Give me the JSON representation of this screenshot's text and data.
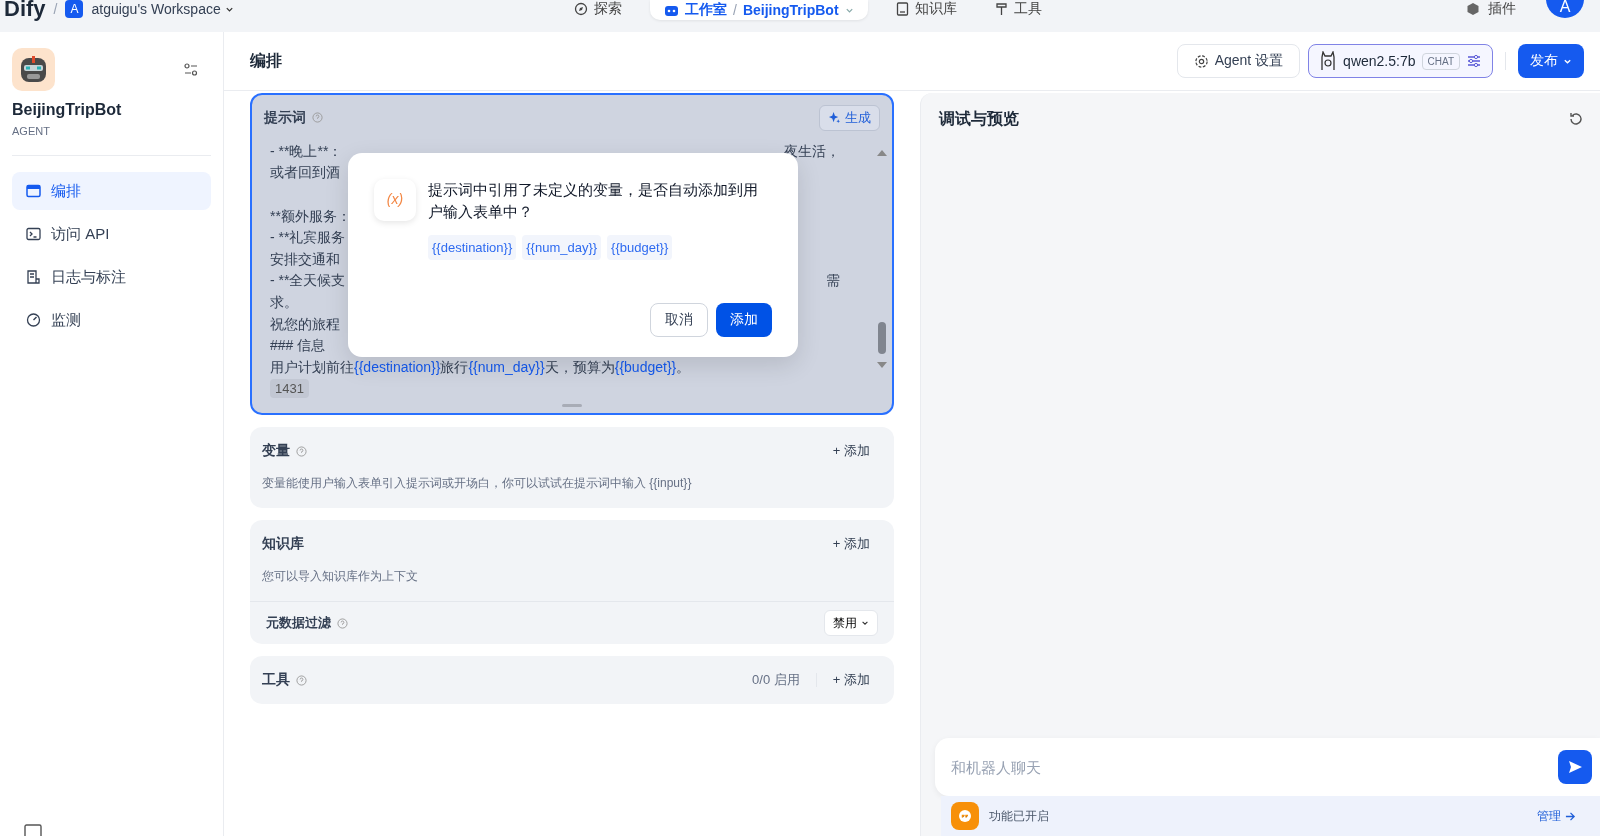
{
  "topbar": {
    "logo": "Dify",
    "separator": "/",
    "app_separator": "/",
    "workspace_initial": "A",
    "workspace": "atguigu's Workspace",
    "nav": [
      {
        "label": "探索",
        "selected": false,
        "kind": "explore"
      },
      {
        "label": "工作室",
        "selected": true,
        "kind": "studio"
      },
      {
        "label": "知识库",
        "selected": false,
        "kind": "knowledge"
      },
      {
        "label": "工具",
        "selected": false,
        "kind": "tools"
      }
    ],
    "app_name": "BeijingTripBot",
    "plugins": "插件",
    "user_initial": "A"
  },
  "sidebar": {
    "app_name": "BeijingTripBot",
    "app_type": "AGENT",
    "items": [
      {
        "label": "编排",
        "selected": true,
        "kind": "orchestrate"
      },
      {
        "label": "访问 API",
        "selected": false,
        "kind": "api"
      },
      {
        "label": "日志与标注",
        "selected": false,
        "kind": "logs"
      },
      {
        "label": "监测",
        "selected": false,
        "kind": "monitor"
      }
    ]
  },
  "page_title": "编排",
  "header_actions": {
    "agent_settings": "Agent 设置",
    "model": "qwen2.5:7b",
    "model_mode": "CHAT",
    "publish": "发布"
  },
  "prompt": {
    "title": "提示词",
    "generate": "生成",
    "lines": [
      {
        "text": "- **晚上**：",
        "tail": "夜生活，"
      },
      {
        "text": "或者回到酒"
      },
      {
        "blank": true
      },
      {
        "text": "**额外服务："
      },
      {
        "text": "- **礼宾服务"
      },
      {
        "text": "安排交通和"
      },
      {
        "text": "- **全天候支",
        "tail": "需"
      },
      {
        "text": "求。"
      },
      {
        "text": "祝您的旅程"
      },
      {
        "text": "### 信息"
      },
      {
        "segments": [
          {
            "text": "用户计划前往",
            "kind": "plain"
          },
          {
            "text": "{{destination}}",
            "kind": "var"
          },
          {
            "text": "旅行",
            "kind": "plain"
          },
          {
            "text": "{{num_day}}",
            "kind": "var"
          },
          {
            "text": "天，预算为",
            "kind": "plain"
          },
          {
            "text": "{{budget}}",
            "kind": "var"
          },
          {
            "text": "。",
            "kind": "plain"
          }
        ]
      }
    ],
    "char_count": "1431"
  },
  "modal": {
    "icon_text": "(x)",
    "message": "提示词中引用了未定义的变量，是否自动添加到用户输入表单中？",
    "variables": [
      "{{destination}}",
      "{{num_day}}",
      "{{budget}}"
    ],
    "cancel": "取消",
    "confirm": "添加"
  },
  "variables_section": {
    "title": "变量",
    "add": "+ 添加",
    "description": "变量能使用户输入表单引入提示词或开场白，你可以试试在提示词中输入 {{input}}"
  },
  "knowledge_section": {
    "title": "知识库",
    "add": "+ 添加",
    "description": "您可以导入知识库作为上下文",
    "metadata_filter": "元数据过滤",
    "metadata_value": "禁用"
  },
  "tools_section": {
    "title": "工具",
    "count": "0/0 启用",
    "add": "+ 添加"
  },
  "preview": {
    "title": "调试与预览",
    "chat_placeholder": "和机器人聊天",
    "features": "功能已开启",
    "manage": "管理"
  }
}
